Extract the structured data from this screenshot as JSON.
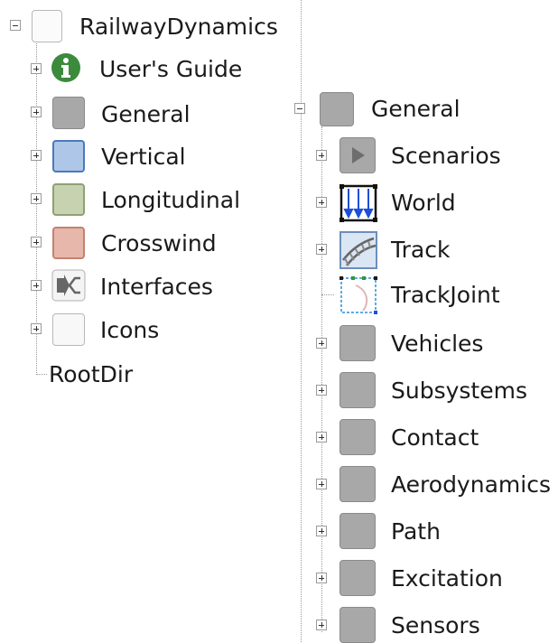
{
  "left_tree": {
    "root": {
      "label": "RailwayDynamics",
      "icon": "package-icon"
    },
    "children": [
      {
        "label": "User's Guide",
        "icon": "info-icon",
        "color": "#3c8a3c"
      },
      {
        "label": "General",
        "icon": "package-gray-icon",
        "color": "#a8a8a8"
      },
      {
        "label": "Vertical",
        "icon": "package-blue-icon",
        "color": "#aec7e8"
      },
      {
        "label": "Longitudinal",
        "icon": "package-green-icon",
        "color": "#c7d3b0"
      },
      {
        "label": "Crosswind",
        "icon": "package-red-icon",
        "color": "#e6b7aa"
      },
      {
        "label": "Interfaces",
        "icon": "interfaces-icon"
      },
      {
        "label": "Icons",
        "icon": "package-white-icon"
      },
      {
        "label": "RootDir"
      }
    ]
  },
  "right_tree": {
    "root": {
      "label": "General",
      "icon": "package-gray-icon"
    },
    "children": [
      {
        "label": "Scenarios",
        "icon": "scenarios-icon"
      },
      {
        "label": "World",
        "icon": "world-icon"
      },
      {
        "label": "Track",
        "icon": "track-icon"
      },
      {
        "label": "TrackJoint",
        "icon": "trackjoint-icon"
      },
      {
        "label": "Vehicles",
        "icon": "package-gray-icon"
      },
      {
        "label": "Subsystems",
        "icon": "package-gray-icon"
      },
      {
        "label": "Contact",
        "icon": "package-gray-icon"
      },
      {
        "label": "Aerodynamics",
        "icon": "package-gray-icon"
      },
      {
        "label": "Path",
        "icon": "package-gray-icon"
      },
      {
        "label": "Excitation",
        "icon": "package-gray-icon"
      },
      {
        "label": "Sensors",
        "icon": "package-gray-icon"
      }
    ]
  }
}
